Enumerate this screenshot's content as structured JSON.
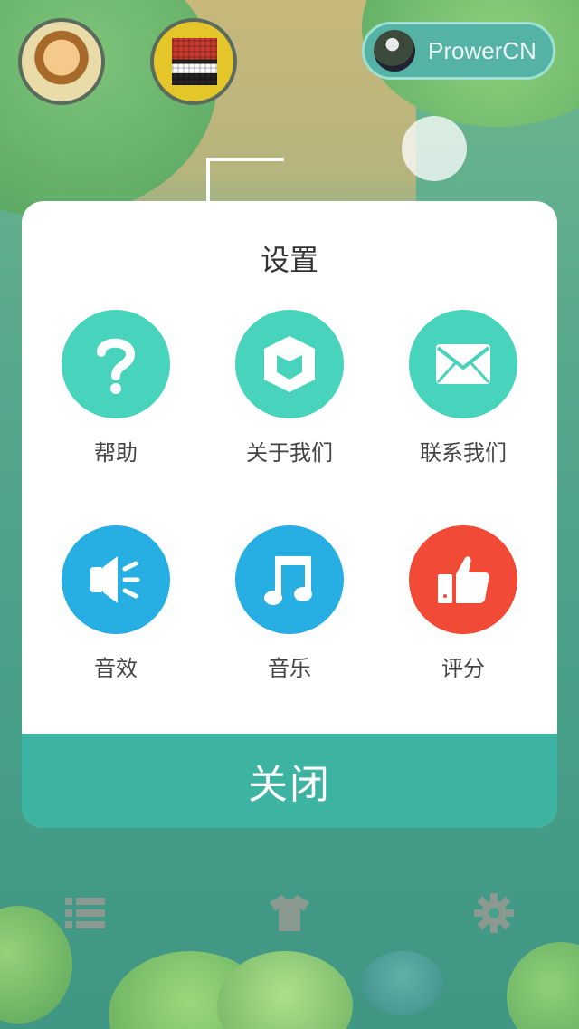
{
  "header": {
    "username": "ProwerCN"
  },
  "dialog": {
    "title": "设置",
    "items": [
      {
        "label": "帮助",
        "icon": "help-icon",
        "color": "#48d3bc"
      },
      {
        "label": "关于我们",
        "icon": "cube-icon",
        "color": "#48d3bc"
      },
      {
        "label": "联系我们",
        "icon": "mail-icon",
        "color": "#48d3bc"
      },
      {
        "label": "音效",
        "icon": "speaker-icon",
        "color": "#27aee3"
      },
      {
        "label": "音乐",
        "icon": "music-icon",
        "color": "#27aee3"
      },
      {
        "label": "评分",
        "icon": "thumbs-up-icon",
        "color": "#f14a36"
      }
    ],
    "close_label": "关闭",
    "close_color": "#3db3a1"
  },
  "toolbar": {
    "icons": [
      "list-icon",
      "shirt-icon",
      "gear-icon"
    ]
  }
}
